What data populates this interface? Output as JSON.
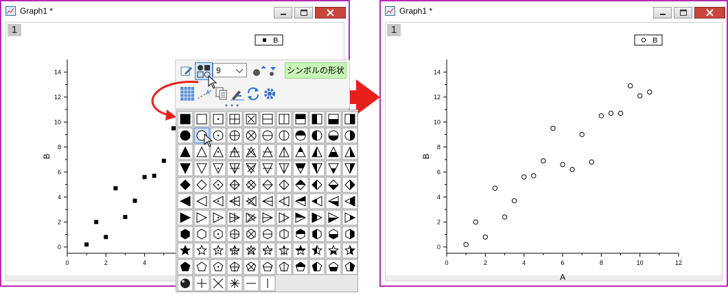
{
  "left_window": {
    "title": "Graph1 *",
    "layer_tab": "1"
  },
  "right_window": {
    "title": "Graph1 *",
    "layer_tab": "1"
  },
  "mini_toolbar": {
    "size_value": "9",
    "tooltip": "シンボルの形状"
  },
  "colors": {
    "window_border": "#b32bb0",
    "arrow": "#e8201c",
    "tooltip_bg": "#c8f5b8"
  },
  "icons": [
    "edit-icon",
    "symbol-shape-icon",
    "dropdown-chevron-icon",
    "symbol-color-icon",
    "fill-pattern-icon",
    "connect-icon",
    "copy-format-icon",
    "paste-format-icon",
    "refresh-icon",
    "gear-icon"
  ],
  "chart_data": [
    {
      "type": "scatter",
      "title": "",
      "xlabel": "",
      "ylabel": "B",
      "xlim": [
        0,
        12
      ],
      "ylim": [
        -0.5,
        15
      ],
      "xticks": [
        0,
        2,
        4
      ],
      "yticks": [
        0,
        2,
        4,
        6,
        8,
        10,
        12,
        14
      ],
      "marker": "filled-square",
      "legend": {
        "entries": [
          "B"
        ],
        "placement": "top-right"
      },
      "series": [
        {
          "name": "B",
          "x": [
            1,
            1.5,
            2,
            2.5,
            3,
            3.5,
            4,
            4.5,
            5,
            5.5
          ],
          "y": [
            0.2,
            2.0,
            0.8,
            4.7,
            2.4,
            3.7,
            5.6,
            5.7,
            6.9,
            9.5
          ]
        }
      ]
    },
    {
      "type": "scatter",
      "title": "",
      "xlabel": "A",
      "ylabel": "B",
      "xlim": [
        0,
        12
      ],
      "ylim": [
        -0.5,
        15
      ],
      "xticks": [
        0,
        2,
        4,
        6,
        8,
        10,
        12
      ],
      "yticks": [
        0,
        2,
        4,
        6,
        8,
        10,
        12,
        14
      ],
      "marker": "open-circle",
      "legend": {
        "entries": [
          "B"
        ],
        "placement": "top-right"
      },
      "series": [
        {
          "name": "B",
          "x": [
            1,
            1.5,
            2,
            2.5,
            3,
            3.5,
            4,
            4.5,
            5,
            5.5,
            6,
            6.5,
            7,
            7.5,
            8,
            8.5,
            9,
            9.5,
            10,
            10.5
          ],
          "y": [
            0.2,
            2.0,
            0.8,
            4.7,
            2.4,
            3.7,
            5.6,
            5.7,
            6.9,
            9.5,
            6.6,
            6.2,
            9.0,
            6.8,
            10.5,
            10.7,
            10.7,
            12.9,
            12.1,
            12.4
          ]
        }
      ]
    }
  ]
}
